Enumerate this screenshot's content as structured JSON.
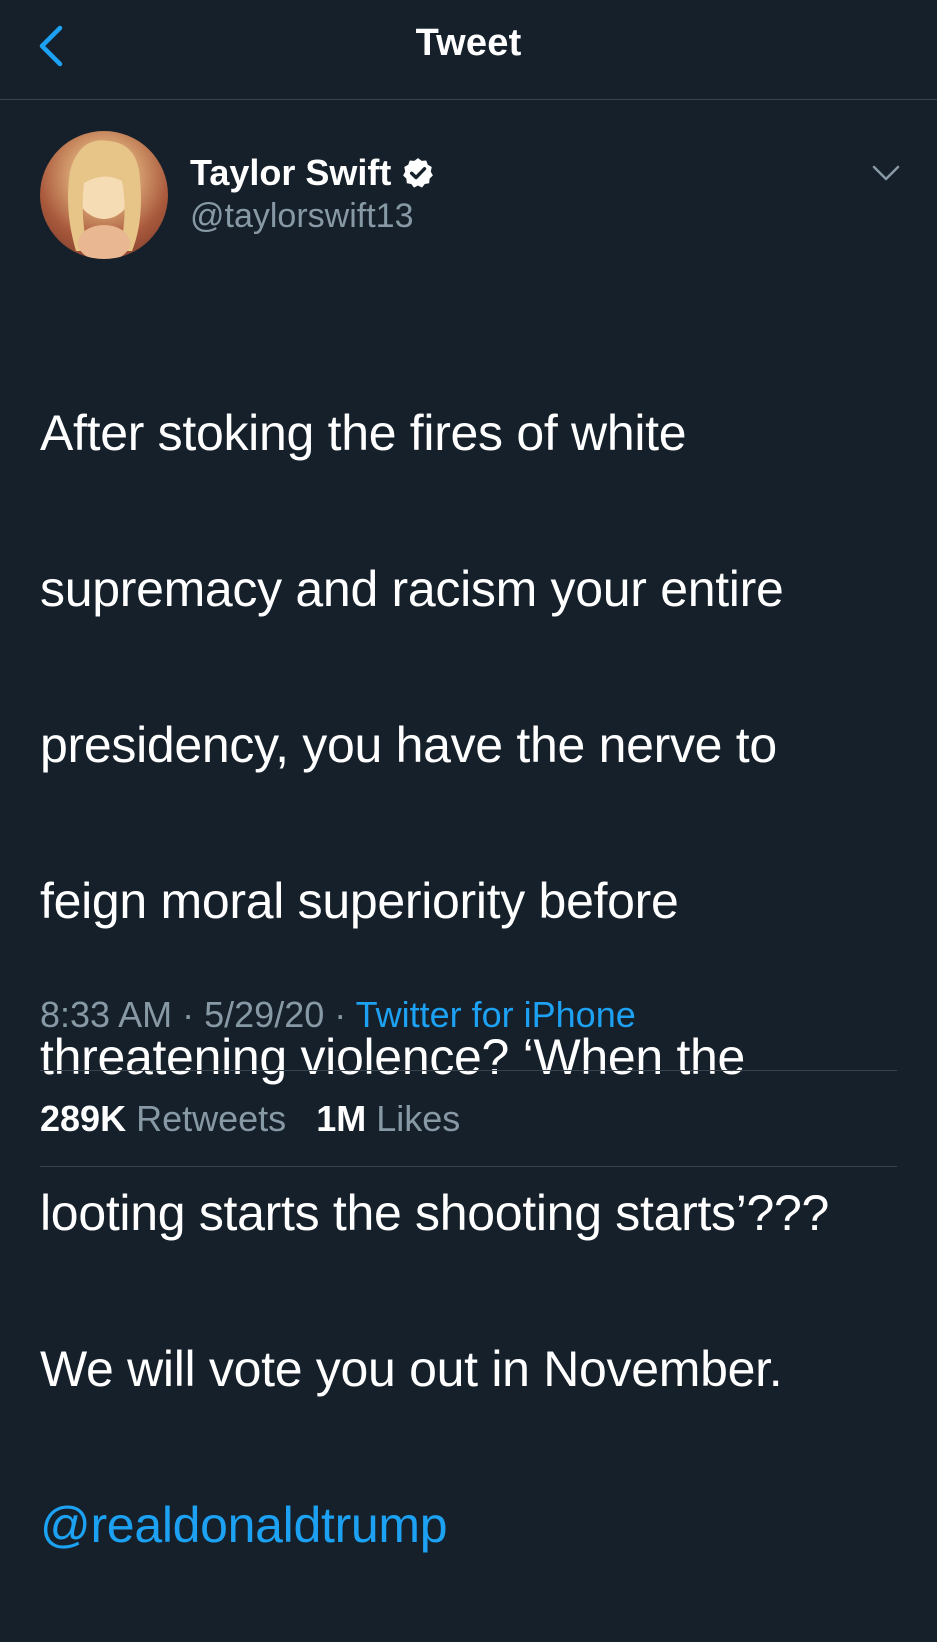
{
  "header": {
    "title": "Tweet",
    "back_icon": "chevron-left-icon"
  },
  "author": {
    "name": "Taylor Swift",
    "handle": "@taylorswift13",
    "verified_icon": "verified-badge-icon",
    "menu_icon": "chevron-down-icon"
  },
  "tweet": {
    "text_lines": [
      "After stoking the fires of white",
      "supremacy and racism your entire",
      "presidency, you have the nerve to",
      "feign moral superiority before",
      "threatening violence? ‘When the",
      "looting starts the shooting starts’???",
      "We will vote you out in November."
    ],
    "mention": "@realdonaldtrump"
  },
  "meta": {
    "time": "8:33 AM",
    "separator": "·",
    "date": "5/29/20",
    "source": "Twitter for iPhone"
  },
  "stats": {
    "retweets_count": "289K",
    "retweets_label": "Retweets",
    "likes_count": "1M",
    "likes_label": "Likes"
  },
  "colors": {
    "background": "#15202b",
    "accent": "#1da1f2",
    "secondary_text": "#8899a6",
    "divider": "#38444d"
  }
}
